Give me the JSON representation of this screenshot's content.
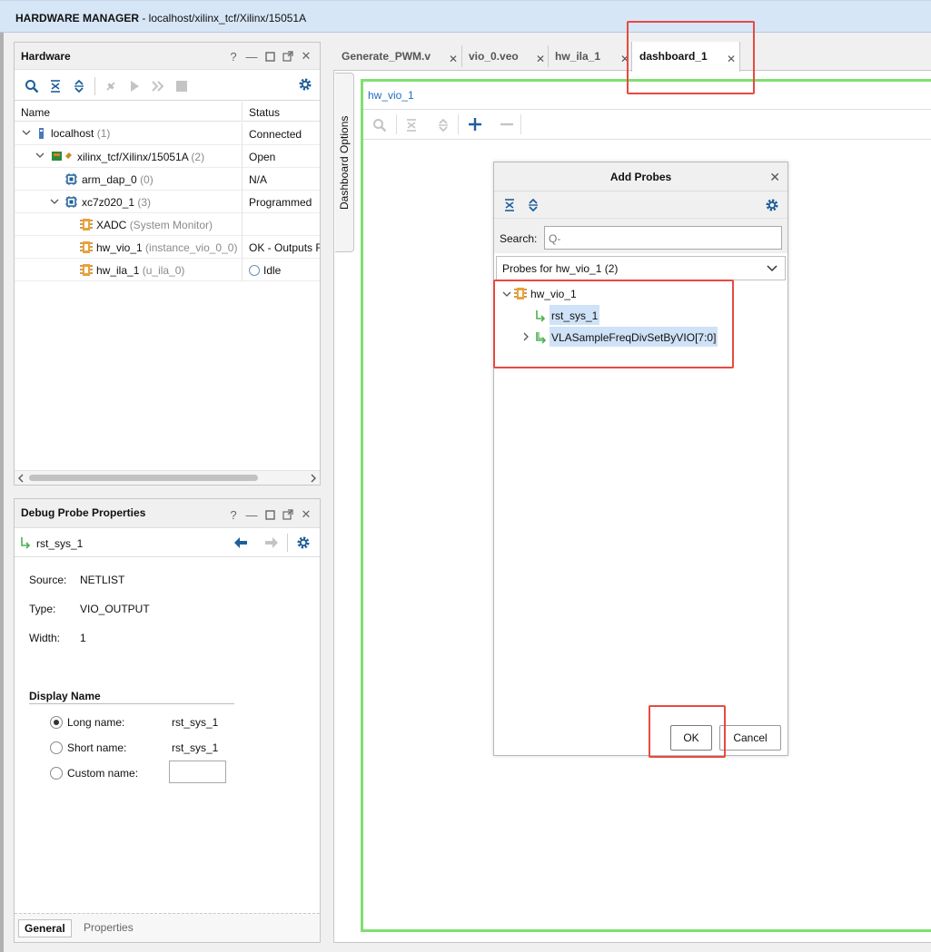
{
  "title_bar": {
    "label": "HARDWARE MANAGER",
    "path": " - localhost/xilinx_tcf/Xilinx/15051A"
  },
  "hardware_panel": {
    "title": "Hardware",
    "columns": {
      "name": "Name",
      "status": "Status"
    },
    "rows": [
      {
        "name": "localhost",
        "detail": "(1)",
        "status": "Connected",
        "icon": "server-icon"
      },
      {
        "name": "xilinx_tcf/Xilinx/15051A",
        "detail": "(2)",
        "status": "Open",
        "icon": "target-board-icon"
      },
      {
        "name": "arm_dap_0",
        "detail": "(0)",
        "status": "N/A",
        "icon": "chip-icon"
      },
      {
        "name": "xc7z020_1",
        "detail": "(3)",
        "status": "Programmed",
        "icon": "chip-icon"
      },
      {
        "name": "XADC",
        "detail": "(System Monitor)",
        "status": "",
        "icon": "debug-core-icon"
      },
      {
        "name": "hw_vio_1",
        "detail": "(instance_vio_0_0)",
        "status": "OK - Outputs F",
        "icon": "debug-core-icon"
      },
      {
        "name": "hw_ila_1",
        "detail": "(u_ila_0)",
        "status": "Idle",
        "icon": "debug-core-icon"
      }
    ]
  },
  "debug_probe_panel": {
    "title": "Debug Probe Properties",
    "probe_name": "rst_sys_1",
    "properties": [
      {
        "label": "Source:",
        "value": "NETLIST"
      },
      {
        "label": "Type:",
        "value": "VIO_OUTPUT"
      },
      {
        "label": "Width:",
        "value": "1"
      }
    ],
    "display_name_header": "Display Name",
    "long_name_label": "Long name:",
    "long_name_value": "rst_sys_1",
    "short_name_label": "Short name:",
    "short_name_value": "rst_sys_1",
    "custom_name_label": "Custom name:",
    "custom_name_value": "",
    "bottom_tabs": {
      "general": "General",
      "properties": "Properties"
    }
  },
  "editor_tabs": [
    {
      "label": "Generate_PWM.v"
    },
    {
      "label": "vio_0.veo"
    },
    {
      "label": "hw_ila_1"
    },
    {
      "label": "dashboard_1"
    }
  ],
  "dashboard": {
    "side_label": "Dashboard Options",
    "vio_label": "hw_vio_1"
  },
  "add_probes_dialog": {
    "title": "Add Probes",
    "search_label": "Search:",
    "search_placeholder": "Q-",
    "dropdown_value": "Probes for hw_vio_1 (2)",
    "tree_root": "hw_vio_1",
    "probes": [
      "rst_sys_1",
      "VLASampleFreqDivSetByVIO[7:0]"
    ],
    "ok_label": "OK",
    "cancel_label": "Cancel"
  },
  "colors": {
    "title_bg": "#d6e6f7",
    "highlight": "#cfe2f7",
    "accent_blue": "#1f5f99",
    "dashboard_border": "#7ee06f",
    "annotation_red": "#e84a40"
  }
}
